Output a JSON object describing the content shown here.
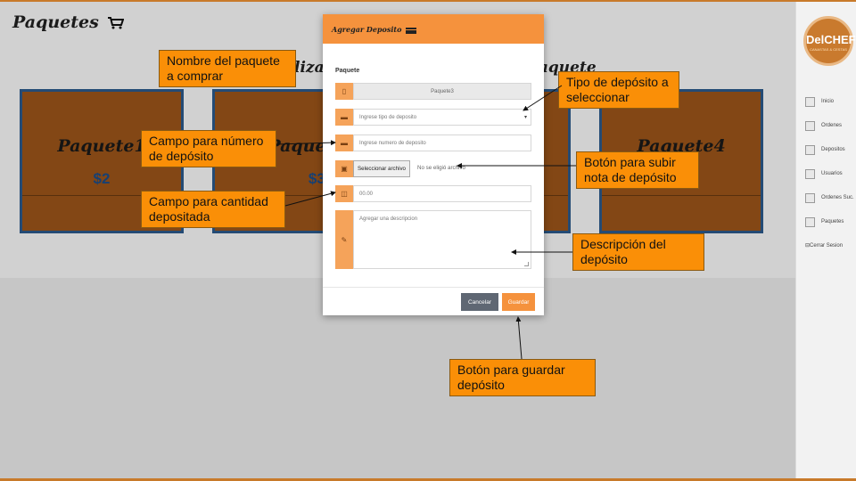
{
  "page": {
    "title": "Paquetes",
    "subtitle_left": "lizar",
    "subtitle_right": "paquete",
    "packages": [
      {
        "name": "Paquete1",
        "price": "$2"
      },
      {
        "name": "Paquete2",
        "price": "$30"
      },
      {
        "name": "",
        "price": ""
      },
      {
        "name": "Paquete4",
        "price": ""
      }
    ]
  },
  "sidebar": {
    "logo_text": "DelCHEF",
    "logo_sub": "CANASTAS & CESTAS",
    "items": [
      {
        "label": "Inicio",
        "icon": "home-icon"
      },
      {
        "label": "Ordenes",
        "icon": "orders-icon"
      },
      {
        "label": "Depositos",
        "icon": "deposit-icon"
      },
      {
        "label": "Usuarios",
        "icon": "users-icon"
      },
      {
        "label": "Ordenes Suc.",
        "icon": "branch-orders-icon"
      },
      {
        "label": "Paquetes",
        "icon": "packages-icon"
      }
    ],
    "logout": "Cerrar Sesion"
  },
  "modal": {
    "title": "Agregar Deposito",
    "label_package": "Paquete",
    "package_value": "Paquete3",
    "type_placeholder": "Ingrese tipo de deposito",
    "number_placeholder": "Ingrese numero de deposito",
    "file_button": "Seleccionar archivo",
    "file_status": "No se eligió archivo",
    "amount_placeholder": "00.00",
    "description_placeholder": "Agregar una descripcion",
    "cancel": "Cancelar",
    "save": "Guardar"
  },
  "callouts": {
    "package_name": "Nombre del paquete a comprar",
    "deposit_type": "Tipo de depósito a seleccionar",
    "deposit_number": "Campo para número de depósito",
    "upload": "Botón para subir nota de depósito",
    "amount": "Campo para cantidad depositada",
    "description": "Descripción del depósito",
    "save": "Botón para guardar depósito"
  },
  "colors": {
    "accent": "#f5923d",
    "callout": "#fa8f07",
    "card": "#a0571a",
    "card_border": "#2d5c8f"
  }
}
